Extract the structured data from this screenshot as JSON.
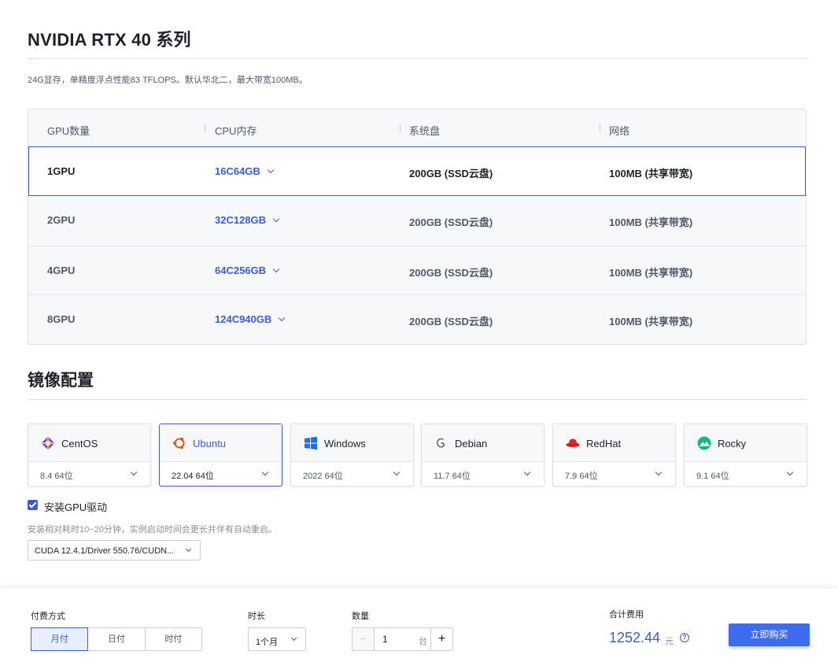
{
  "title": "NVIDIA RTX 40 系列",
  "description": "24G显存，单精度浮点性能83 TFLOPS。默认华北二，最大带宽100MB。",
  "spec_table": {
    "headers": [
      "GPU数量",
      "CPU内存",
      "系统盘",
      "网络"
    ],
    "rows": [
      {
        "gpu": "1GPU",
        "cpu": "16C64GB",
        "disk": "200GB (SSD云盘)",
        "net": "100MB (共享带宽)",
        "selected": true
      },
      {
        "gpu": "2GPU",
        "cpu": "32C128GB",
        "disk": "200GB (SSD云盘)",
        "net": "100MB (共享带宽)",
        "selected": false
      },
      {
        "gpu": "4GPU",
        "cpu": "64C256GB",
        "disk": "200GB (SSD云盘)",
        "net": "100MB (共享带宽)",
        "selected": false
      },
      {
        "gpu": "8GPU",
        "cpu": "124C940GB",
        "disk": "200GB (SSD云盘)",
        "net": "100MB (共享带宽)",
        "selected": false
      }
    ]
  },
  "image_section": {
    "title": "镜像配置",
    "os_options": [
      {
        "name": "CentOS",
        "version": "8.4 64位",
        "icon": "centos-icon",
        "selected": false
      },
      {
        "name": "Ubuntu",
        "version": "22.04 64位",
        "icon": "ubuntu-icon",
        "selected": true
      },
      {
        "name": "Windows",
        "version": "2022 64位",
        "icon": "windows-icon",
        "selected": false
      },
      {
        "name": "Debian",
        "version": "11.7 64位",
        "icon": "debian-icon",
        "selected": false
      },
      {
        "name": "RedHat",
        "version": "7.9 64位",
        "icon": "redhat-icon",
        "selected": false
      },
      {
        "name": "Rocky",
        "version": "9.1 64位",
        "icon": "rocky-icon",
        "selected": false
      }
    ],
    "gpu_driver_checkbox_label": "安装GPU驱动",
    "gpu_driver_checked": true,
    "gpu_driver_note": "安装相对耗时10~20分钟，实例启动时间会更长并伴有自动重启。",
    "cuda_select_value": "CUDA 12.4.1/Driver 550.76/CUDN..."
  },
  "footer": {
    "billing_label": "付费方式",
    "billing_options": [
      "月付",
      "日付",
      "时付"
    ],
    "billing_selected": "月付",
    "duration_label": "时长",
    "duration_value": "1个月",
    "quantity_label": "数量",
    "quantity_minus": "−",
    "quantity_value": "1",
    "quantity_unit": "台",
    "quantity_plus": "+",
    "total_label": "合计费用",
    "total_price": "1252.44",
    "total_unit": "元",
    "help_glyph": "?",
    "buy_label": "立即购买"
  },
  "colors": {
    "accent": "#3b5bdb",
    "button": "#3f6bf0"
  }
}
